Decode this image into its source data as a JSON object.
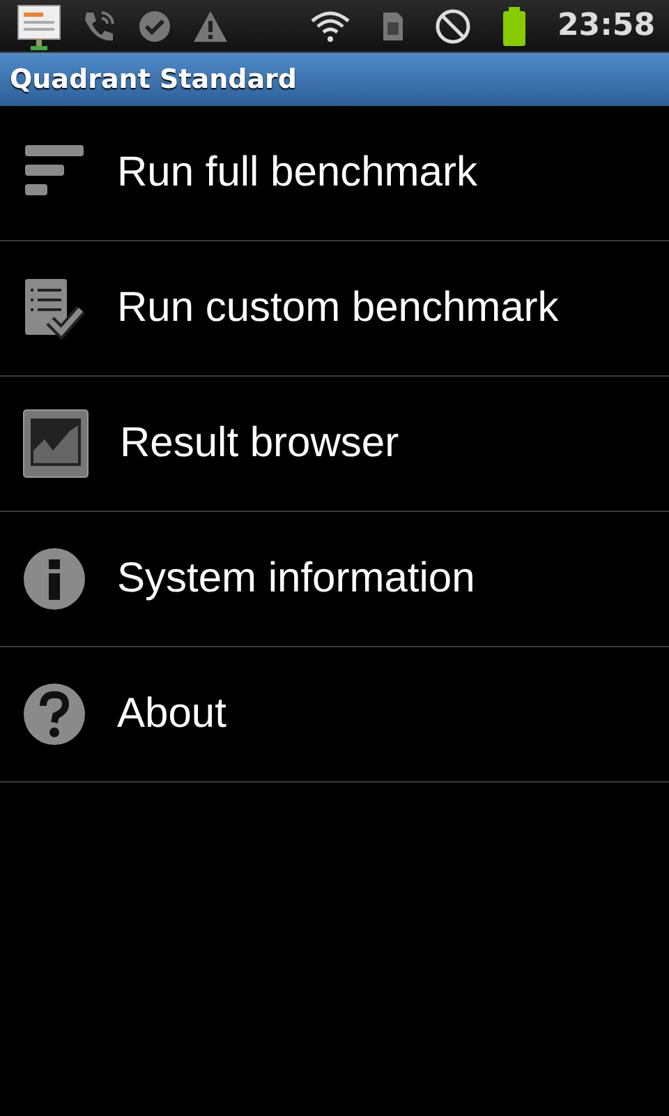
{
  "status_bar": {
    "time": "23:58"
  },
  "title_bar": {
    "title": "Quadrant Standard"
  },
  "menu": [
    {
      "kind": "full",
      "label": "Run full benchmark"
    },
    {
      "kind": "custom",
      "label": "Run custom benchmark"
    },
    {
      "kind": "results",
      "label": "Result browser"
    },
    {
      "kind": "info",
      "label": "System information"
    },
    {
      "kind": "about",
      "label": "About"
    }
  ]
}
